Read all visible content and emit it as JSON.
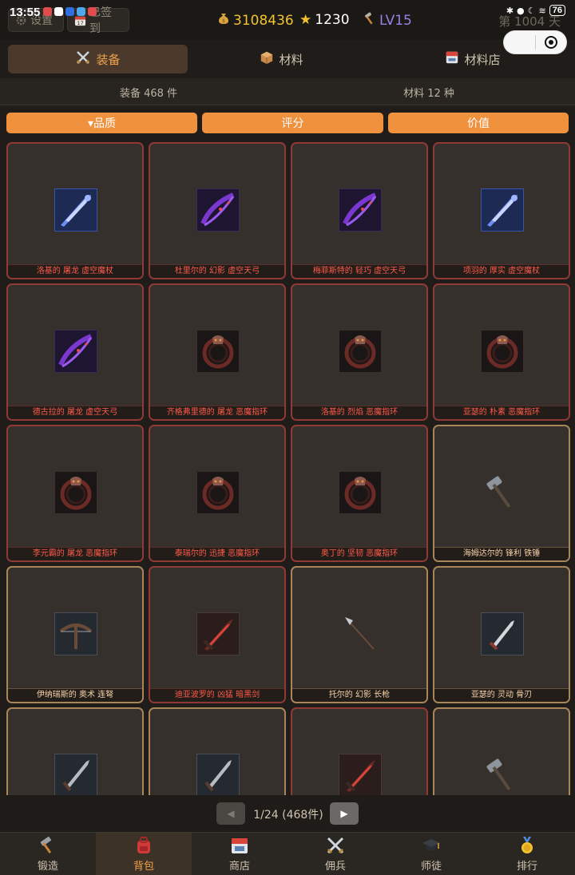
{
  "status_bar": {
    "time": "13:55",
    "battery": "76"
  },
  "header": {
    "settings_label": "设置",
    "checkin_label": "已签到",
    "gold": "3108436",
    "stars": "1230",
    "level": "LV15",
    "days": "第 1004 天"
  },
  "capsule": {
    "more": "•••"
  },
  "tabs": [
    {
      "label": "装备",
      "icon": "crossed-swords-icon"
    },
    {
      "label": "材料",
      "icon": "crate-icon"
    },
    {
      "label": "材料店",
      "icon": "shop-icon"
    }
  ],
  "counts": {
    "equipment": "装备 468 件",
    "materials": "材料 12 种"
  },
  "sort": {
    "quality": "▾品质",
    "score": "评分",
    "value": "价值"
  },
  "items": [
    {
      "name": "洛基的 屠龙 虚空魔杖",
      "icon": "void-staff-icon",
      "rarity": "red"
    },
    {
      "name": "杜里尔的 幻影 虚空天弓",
      "icon": "void-bow-icon",
      "rarity": "red"
    },
    {
      "name": "梅菲斯特的 轻巧 虚空天弓",
      "icon": "void-bow-icon",
      "rarity": "red"
    },
    {
      "name": "项羽的 厚实 虚空魔杖",
      "icon": "void-staff-icon",
      "rarity": "red"
    },
    {
      "name": "德古拉的 屠龙 虚空天弓",
      "icon": "void-bow-icon",
      "rarity": "red"
    },
    {
      "name": "齐格弗里德的 屠龙 恶魔指环",
      "icon": "demon-ring-icon",
      "rarity": "red"
    },
    {
      "name": "洛基的 烈焰 恶魔指环",
      "icon": "demon-ring-icon",
      "rarity": "red"
    },
    {
      "name": "亚瑟的 朴素 恶魔指环",
      "icon": "demon-ring-icon",
      "rarity": "red"
    },
    {
      "name": "李元霸的 屠龙 恶魔指环",
      "icon": "demon-ring-icon",
      "rarity": "red"
    },
    {
      "name": "泰瑞尔的 迅捷 恶魔指环",
      "icon": "demon-ring-icon",
      "rarity": "red"
    },
    {
      "name": "奥丁的 坚韧 恶魔指环",
      "icon": "demon-ring-icon",
      "rarity": "red"
    },
    {
      "name": "海姆达尔的 锋利 铁锤",
      "icon": "iron-hammer-icon",
      "rarity": "gold"
    },
    {
      "name": "伊纳瑞斯的 奥术 连弩",
      "icon": "crossbow-icon",
      "rarity": "gold"
    },
    {
      "name": "迪亚波罗的 凶猛 暗黑剑",
      "icon": "dark-sword-icon",
      "rarity": "red"
    },
    {
      "name": "托尔的 幻影 长枪",
      "icon": "spear-icon",
      "rarity": "gold"
    },
    {
      "name": "亚瑟的 灵动 骨刃",
      "icon": "bone-blade-icon",
      "rarity": "gold"
    },
    {
      "name": "",
      "icon": "dagger-icon",
      "rarity": "gold"
    },
    {
      "name": "",
      "icon": "dagger-icon",
      "rarity": "gold"
    },
    {
      "name": "",
      "icon": "dark-sword-icon",
      "rarity": "red"
    },
    {
      "name": "",
      "icon": "iron-hammer-icon",
      "rarity": "gold"
    }
  ],
  "pagination": {
    "prev": "◀",
    "text": "1/24 (468件)",
    "next": "▶"
  },
  "bottom_nav": [
    {
      "label": "锻造",
      "icon": "hammer-icon"
    },
    {
      "label": "背包",
      "icon": "backpack-icon"
    },
    {
      "label": "商店",
      "icon": "shop-icon"
    },
    {
      "label": "佣兵",
      "icon": "crossed-swords-icon"
    },
    {
      "label": "师徒",
      "icon": "graduation-cap-icon"
    },
    {
      "label": "排行",
      "icon": "medal-icon"
    }
  ],
  "colors": {
    "accent": "#f0913e",
    "legendary_text": "#ff5a4a",
    "legendary_border": "#8f3a35",
    "set_text": "#f7d2a8",
    "set_border": "#a8865a",
    "gold_text": "#f2c230",
    "level_text": "#9b7fe8"
  }
}
